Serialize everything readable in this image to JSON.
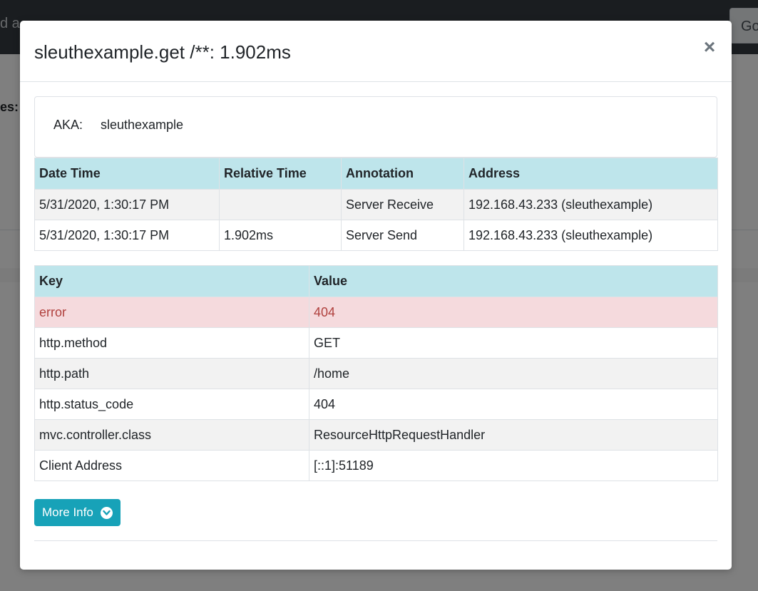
{
  "background": {
    "search_text": "d a",
    "go_button": "Go",
    "left_label": "es:"
  },
  "modal": {
    "title": "sleuthexample.get /**: 1.902ms",
    "close_label": "×",
    "aka": {
      "label": "AKA:",
      "value": "sleuthexample"
    },
    "annotations": {
      "headers": [
        "Date Time",
        "Relative Time",
        "Annotation",
        "Address"
      ],
      "rows": [
        [
          "5/31/2020, 1:30:17 PM",
          "",
          "Server Receive",
          "192.168.43.233 (sleuthexample)"
        ],
        [
          "5/31/2020, 1:30:17 PM",
          "1.902ms",
          "Server Send",
          "192.168.43.233 (sleuthexample)"
        ]
      ]
    },
    "tags": {
      "headers": [
        "Key",
        "Value"
      ],
      "rows": [
        [
          "error",
          "404"
        ],
        [
          "http.method",
          "GET"
        ],
        [
          "http.path",
          "/home"
        ],
        [
          "http.status_code",
          "404"
        ],
        [
          "mvc.controller.class",
          "ResourceHttpRequestHandler"
        ],
        [
          "Client Address",
          "[::1]:51189"
        ]
      ]
    },
    "more_info_label": "More Info"
  },
  "colors": {
    "header_bg": "#bee5eb",
    "error_row_bg": "#f5dadd",
    "error_row_text": "#b0413e",
    "button_bg": "#17a2b8"
  }
}
